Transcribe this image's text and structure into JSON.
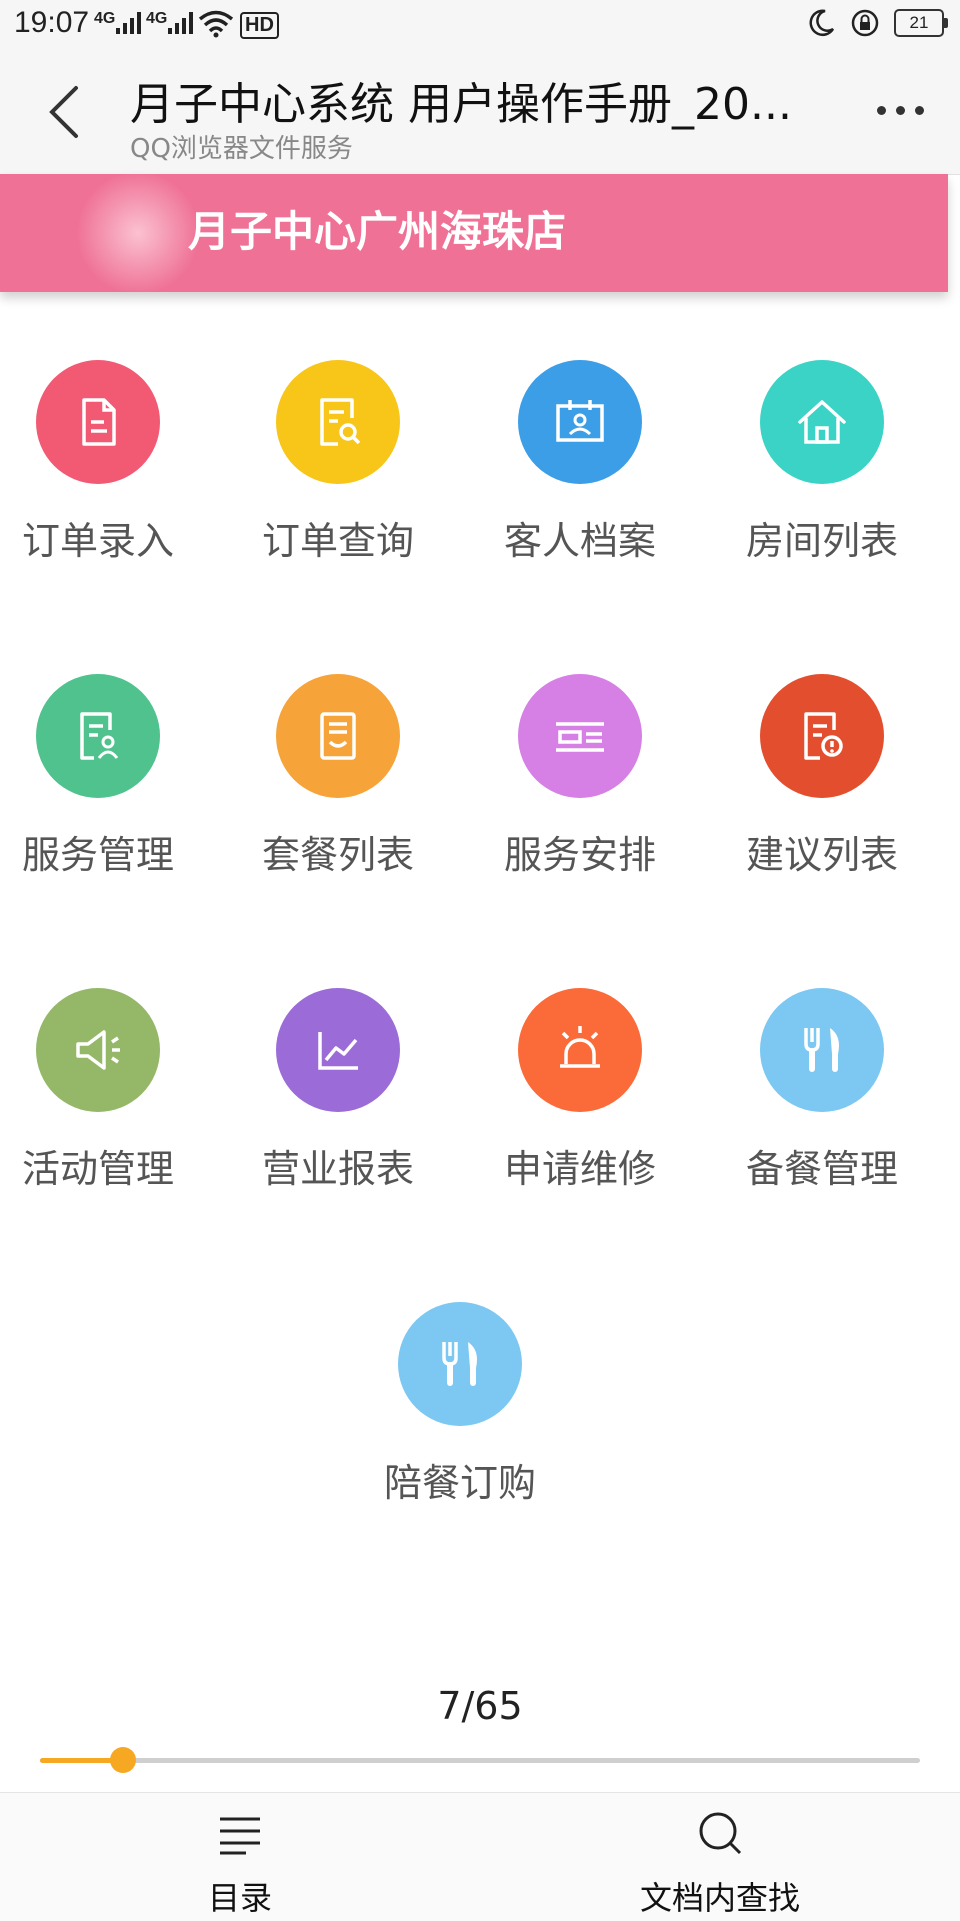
{
  "status_bar": {
    "time": "19:07",
    "signal1": "4G",
    "signal2": "4G",
    "hd": "HD",
    "battery": "21"
  },
  "header": {
    "title": "月子中心系统 用户操作手册_20...",
    "subtitle": "QQ浏览器文件服务"
  },
  "banner": {
    "shop_name": "月子中心广州海珠店",
    "color": "#ef7195"
  },
  "menu": [
    {
      "label": "订单录入",
      "icon": "document-icon",
      "color": "#f25a74"
    },
    {
      "label": "订单查询",
      "icon": "document-search-icon",
      "color": "#f7c619"
    },
    {
      "label": "客人档案",
      "icon": "id-card-icon",
      "color": "#3d9ee8"
    },
    {
      "label": "房间列表",
      "icon": "home-icon",
      "color": "#3ad3c5"
    },
    {
      "label": "服务管理",
      "icon": "document-user-icon",
      "color": "#4fc28d"
    },
    {
      "label": "套餐列表",
      "icon": "receipt-icon",
      "color": "#f6a33a"
    },
    {
      "label": "服务安排",
      "icon": "schedule-icon",
      "color": "#d680e6"
    },
    {
      "label": "建议列表",
      "icon": "document-alert-icon",
      "color": "#e34f2e"
    },
    {
      "label": "活动管理",
      "icon": "megaphone-icon",
      "color": "#95b868"
    },
    {
      "label": "营业报表",
      "icon": "line-chart-icon",
      "color": "#9b6cd8"
    },
    {
      "label": "申请维修",
      "icon": "alarm-light-icon",
      "color": "#fb6b3a"
    },
    {
      "label": "备餐管理",
      "icon": "fork-knife-icon",
      "color": "#7cc8f3"
    },
    {
      "label": "陪餐订购",
      "icon": "fork-knife-icon",
      "color": "#7cc8f3"
    }
  ],
  "pager": {
    "text": "7/65",
    "current": 7,
    "total": 65,
    "accent": "#f7a823"
  },
  "bottom_bar": {
    "toc_label": "目录",
    "search_label": "文档内查找"
  }
}
